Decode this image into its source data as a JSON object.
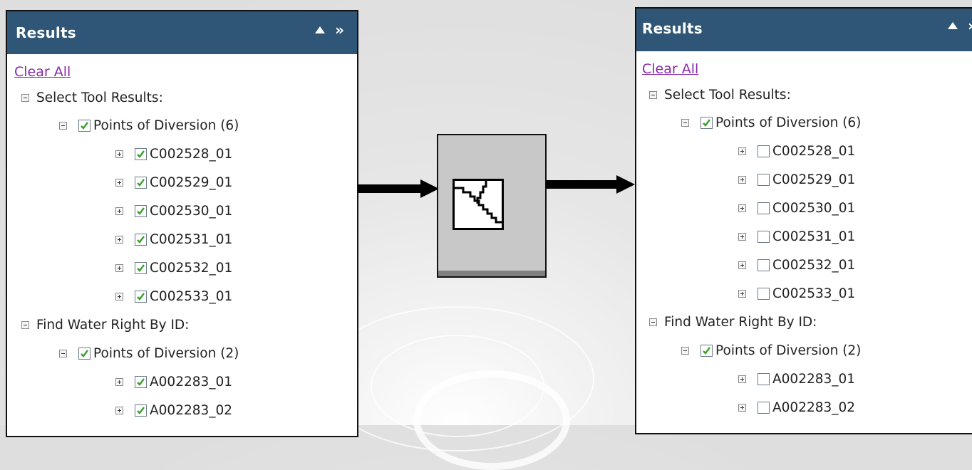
{
  "left_panel": {
    "title": "Results",
    "collapse_glyph": "▲",
    "expand_glyph": "»",
    "clear_all": "Clear All",
    "select_tool_label": "Select Tool Results:",
    "select_group_label": "Points of Diversion (6)",
    "select_items": [
      {
        "label": "C002528_01",
        "checked": true
      },
      {
        "label": "C002529_01",
        "checked": true
      },
      {
        "label": "C002530_01",
        "checked": true
      },
      {
        "label": "C002531_01",
        "checked": true
      },
      {
        "label": "C002532_01",
        "checked": true
      },
      {
        "label": "C002533_01",
        "checked": true
      }
    ],
    "find_label": "Find Water Right By ID:",
    "find_group_label": "Points of Diversion (2)",
    "find_items": [
      {
        "label": "A002283_01",
        "checked": true
      },
      {
        "label": "A002283_02",
        "checked": true
      }
    ]
  },
  "right_panel": {
    "title": "Results",
    "collapse_glyph": "▲",
    "expand_glyph": "»",
    "clear_all": "Clear All",
    "select_tool_label": "Select Tool Results:",
    "select_group_label": "Points of Diversion (6)",
    "select_items": [
      {
        "label": "C002528_01",
        "checked": false
      },
      {
        "label": "C002529_01",
        "checked": false
      },
      {
        "label": "C002530_01",
        "checked": false
      },
      {
        "label": "C002531_01",
        "checked": false
      },
      {
        "label": "C002532_01",
        "checked": false
      },
      {
        "label": "C002533_01",
        "checked": false
      }
    ],
    "find_label": "Find Water Right By ID:",
    "find_group_label": "Points of Diversion (2)",
    "find_items": [
      {
        "label": "A002283_01",
        "checked": false
      },
      {
        "label": "A002283_02",
        "checked": false
      }
    ]
  },
  "icons": {
    "header_collapse": "triangle-up-icon",
    "header_expand": "double-chevron-right-icon",
    "tree_collapse": "minus-box-icon",
    "tree_expand": "plus-box-icon",
    "process": "block-diagram-icon"
  },
  "colors": {
    "header_bg": "#2f5677",
    "link": "#8a2aa8",
    "check": "#3aa02a"
  }
}
